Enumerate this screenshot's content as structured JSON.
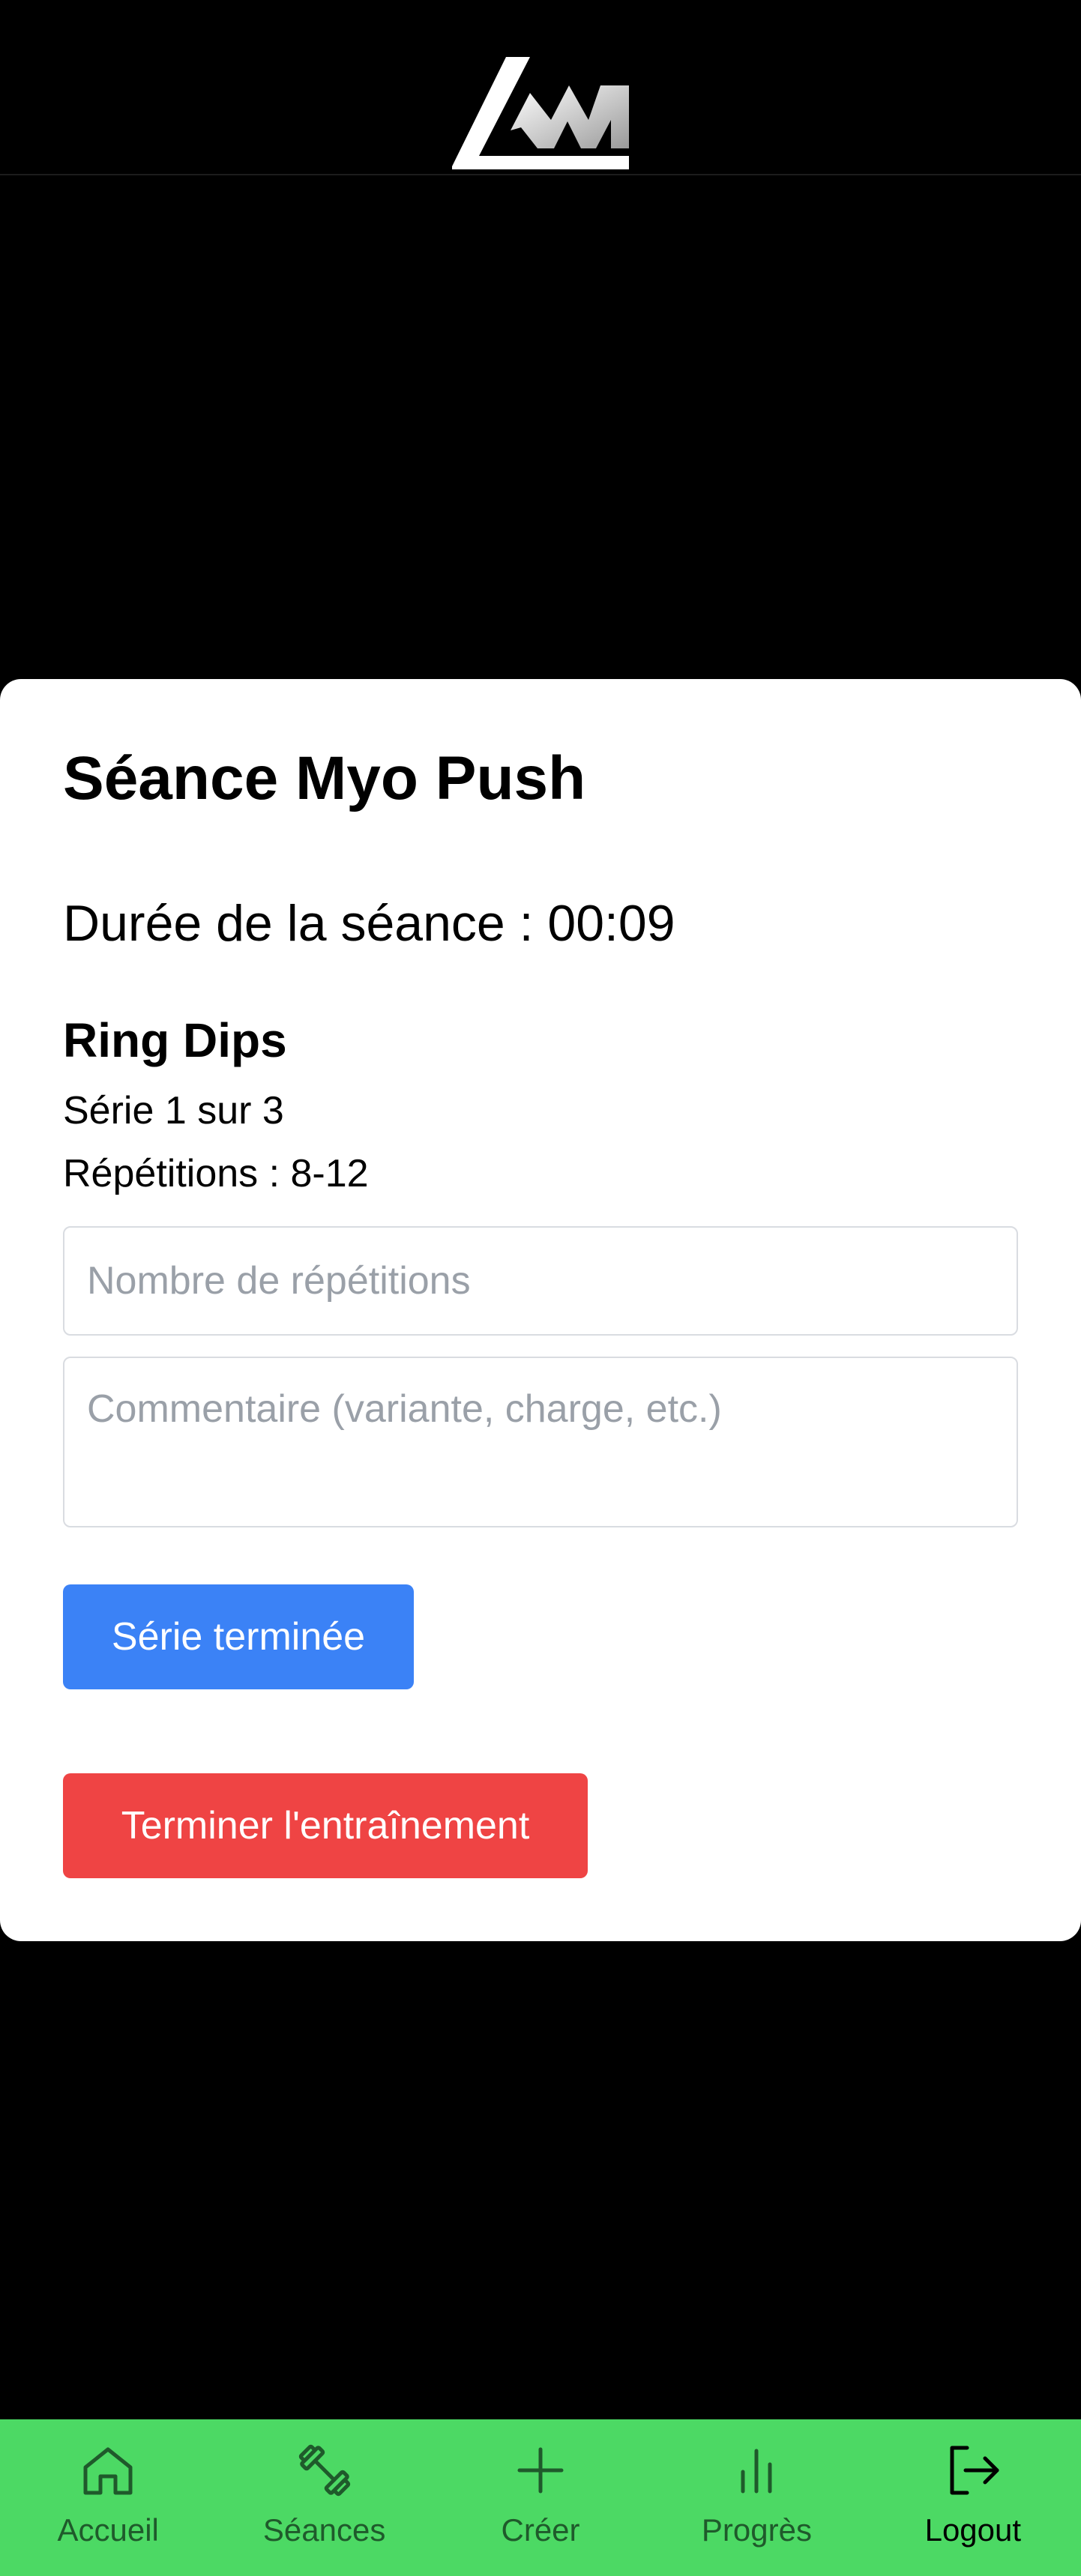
{
  "workout": {
    "title": "Séance Myo Push",
    "duration_text": "Durée de la séance : 00:09"
  },
  "exercise": {
    "name": "Ring Dips",
    "series_text": "Série 1 sur 3",
    "reps_text": "Répétitions : 8-12"
  },
  "form": {
    "reps_placeholder": "Nombre de répétitions",
    "comment_placeholder": "Commentaire (variante, charge, etc.)",
    "series_done_label": "Série terminée",
    "finish_label": "Terminer l'entraînement"
  },
  "nav": {
    "items": [
      {
        "label": "Accueil",
        "icon": "home-icon"
      },
      {
        "label": "Séances",
        "icon": "dumbbell-icon"
      },
      {
        "label": "Créer",
        "icon": "plus-icon"
      },
      {
        "label": "Progrès",
        "icon": "bar-chart-icon"
      },
      {
        "label": "Logout",
        "icon": "logout-icon"
      }
    ]
  },
  "colors": {
    "primary_button": "#3b82f6",
    "danger_button": "#ef4444",
    "navbar": "#4cd964"
  }
}
